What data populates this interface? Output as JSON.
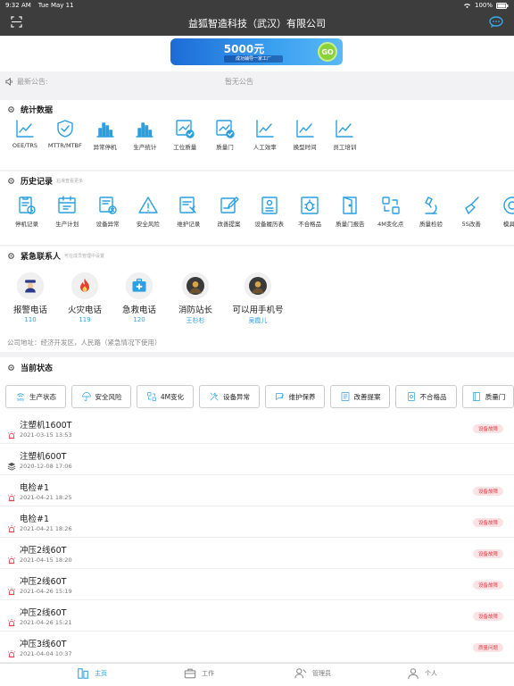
{
  "status": {
    "time": "9:32 AM",
    "date": "Tue May 11",
    "battery": "100%"
  },
  "nav": {
    "title": "益狐智造科技（武汉）有限公司"
  },
  "banner": {
    "amount": "5000元",
    "sub": "成功辅导一家工厂",
    "go": "GO"
  },
  "notice": {
    "label": "最新公告:",
    "message": "暂无公告"
  },
  "stats": {
    "title": "统计数据",
    "items": [
      {
        "label": "OEE/TRS",
        "icon": "line-chart-icon"
      },
      {
        "label": "MTTR/MTBF",
        "icon": "shield-check-icon"
      },
      {
        "label": "异常停机",
        "icon": "bar-chart-icon"
      },
      {
        "label": "生产统计",
        "icon": "bar-chart-icon"
      },
      {
        "label": "工位质量",
        "icon": "chart-check-icon"
      },
      {
        "label": "质量门",
        "icon": "chart-check-icon"
      },
      {
        "label": "人工效率",
        "icon": "line-chart-icon"
      },
      {
        "label": "换型时间",
        "icon": "line-chart-icon"
      },
      {
        "label": "员工培训",
        "icon": "line-chart-icon"
      }
    ]
  },
  "history": {
    "title": "历史记录",
    "hint": "右滑查看更多",
    "items": [
      {
        "label": "停机记录",
        "icon": "clipboard-clock-icon"
      },
      {
        "label": "生产计划",
        "icon": "plan-icon"
      },
      {
        "label": "设备异常",
        "icon": "device-alert-icon"
      },
      {
        "label": "安全风险",
        "icon": "warning-icon"
      },
      {
        "label": "维护记录",
        "icon": "maintenance-icon"
      },
      {
        "label": "改善提案",
        "icon": "edit-icon"
      },
      {
        "label": "设备履历表",
        "icon": "resume-icon"
      },
      {
        "label": "不合格品",
        "icon": "bug-icon"
      },
      {
        "label": "质量门报告",
        "icon": "door-icon"
      },
      {
        "label": "4M变化点",
        "icon": "change-icon"
      },
      {
        "label": "质量检验",
        "icon": "microscope-icon"
      },
      {
        "label": "5S改善",
        "icon": "broom-icon"
      },
      {
        "label": "模具间",
        "icon": "mold-icon"
      }
    ]
  },
  "contacts": {
    "title": "紧急联系人",
    "hint": "可在成员管理中设置",
    "items": [
      {
        "name": "报警电话",
        "phone": "110",
        "icon": "police-icon"
      },
      {
        "name": "火灾电话",
        "phone": "119",
        "icon": "fire-icon"
      },
      {
        "name": "急救电话",
        "phone": "120",
        "icon": "first-aid-icon"
      },
      {
        "name": "消防站长",
        "phone": "王杉杉",
        "icon": "person-photo-icon"
      },
      {
        "name": "可以用手机号",
        "phone": "吴霞儿",
        "icon": "person-photo-icon"
      }
    ],
    "address": "公司地址：经济开发区，人民路（紧急情况下使用）"
  },
  "current": {
    "title": "当前状态"
  },
  "tabs": [
    {
      "label": "生产状态",
      "icon": "sos-icon"
    },
    {
      "label": "安全风险",
      "icon": "umbrella-icon"
    },
    {
      "label": "4M变化",
      "icon": "change-icon"
    },
    {
      "label": "设备异常",
      "icon": "tools-icon"
    },
    {
      "label": "维护保养",
      "icon": "chat-edit-icon"
    },
    {
      "label": "改善提案",
      "icon": "proposal-icon"
    },
    {
      "label": "不合格品",
      "icon": "reject-icon"
    },
    {
      "label": "质量门",
      "icon": "quality-door-icon"
    }
  ],
  "list": [
    {
      "title": "注塑机1600T",
      "date": "2021-03-15 13:53",
      "badge": "设备故障",
      "icon": "alarm-icon"
    },
    {
      "title": "注塑机600T",
      "date": "2020-12-08 17:06",
      "badge": "",
      "icon": "layers-icon"
    },
    {
      "title": "电检#1",
      "date": "2021-04-21 18:25",
      "badge": "设备故障",
      "icon": "alarm-icon"
    },
    {
      "title": "电检#1",
      "date": "2021-04-21 18:26",
      "badge": "设备故障",
      "icon": "alarm-icon"
    },
    {
      "title": "冲压2线60T",
      "date": "2021-04-15 18:20",
      "badge": "设备故障",
      "icon": "alarm-icon"
    },
    {
      "title": "冲压2线60T",
      "date": "2021-04-26 15:19",
      "badge": "设备故障",
      "icon": "alarm-icon"
    },
    {
      "title": "冲压2线60T",
      "date": "2021-04-26 15:21",
      "badge": "设备故障",
      "icon": "alarm-icon"
    },
    {
      "title": "冲压3线60T",
      "date": "2021-04-04 10:37",
      "badge": "质量问题",
      "icon": "alarm-icon"
    }
  ],
  "bottom": [
    {
      "label": "主页",
      "icon": "home-icon",
      "active": true
    },
    {
      "label": "工作",
      "icon": "briefcase-icon",
      "active": false
    },
    {
      "label": "管理员",
      "icon": "admin-icon",
      "active": false
    },
    {
      "label": "个人",
      "icon": "person-icon",
      "active": false
    }
  ],
  "colors": {
    "accent": "#2aa1e6",
    "header": "#3d3d3d",
    "alert": "#e0404a"
  }
}
